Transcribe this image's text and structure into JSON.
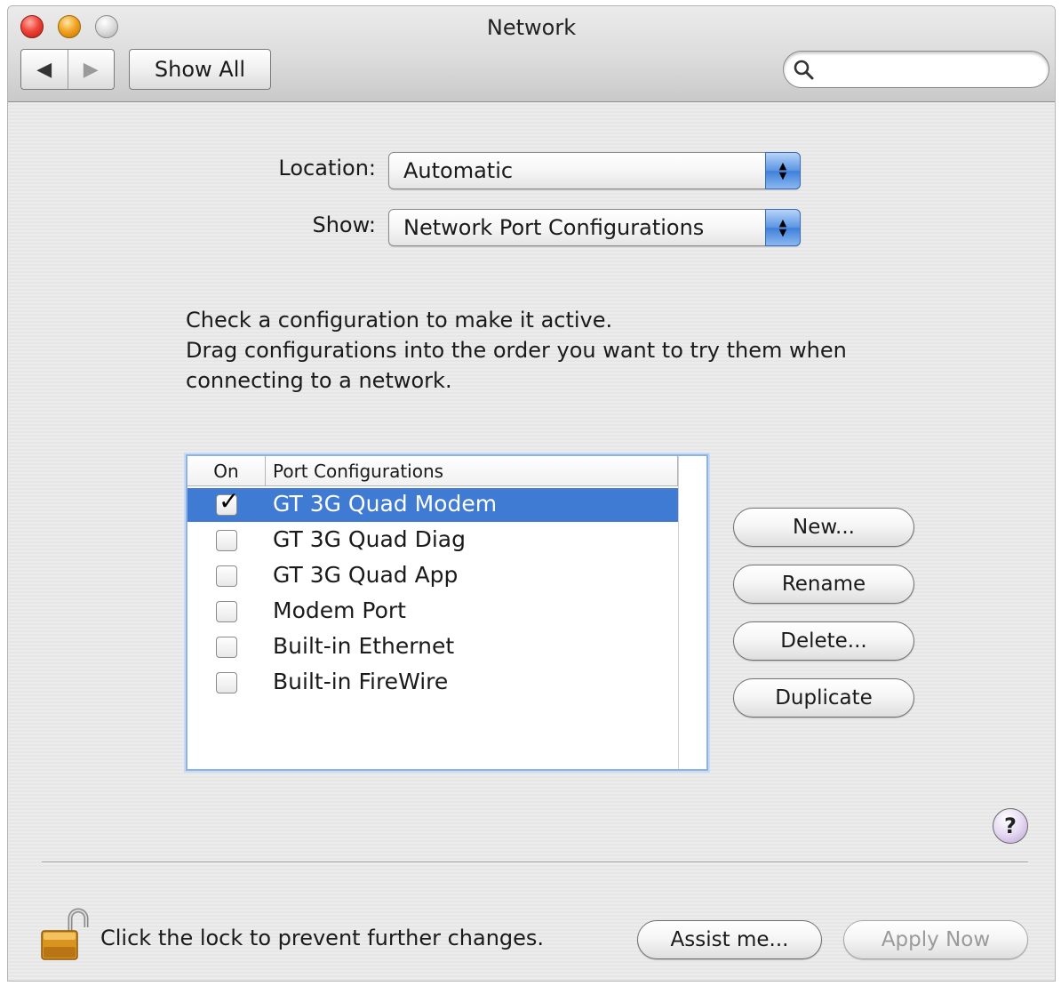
{
  "window": {
    "title": "Network"
  },
  "toolbar": {
    "back_icon": "◀",
    "forward_icon": "▶",
    "show_all_label": "Show All",
    "search_value": "",
    "search_placeholder": ""
  },
  "location": {
    "label": "Location:",
    "value": "Automatic"
  },
  "show": {
    "label": "Show:",
    "value": "Network Port Configurations"
  },
  "instructions": [
    "Check a configuration to make it active.",
    "Drag configurations into the order you want to try them when",
    "connecting to a network."
  ],
  "table": {
    "col_on": "On",
    "col_name": "Port Configurations",
    "rows": [
      {
        "name": "GT 3G Quad Modem",
        "checked": true,
        "selected": true
      },
      {
        "name": "GT 3G Quad Diag",
        "checked": false,
        "selected": false
      },
      {
        "name": "GT 3G Quad App",
        "checked": false,
        "selected": false
      },
      {
        "name": "Modem Port",
        "checked": false,
        "selected": false
      },
      {
        "name": "Built-in Ethernet",
        "checked": false,
        "selected": false
      },
      {
        "name": "Built-in FireWire",
        "checked": false,
        "selected": false
      }
    ]
  },
  "side_buttons": {
    "new": "New...",
    "rename": "Rename",
    "delete": "Delete...",
    "duplicate": "Duplicate"
  },
  "help_label": "?",
  "footer": {
    "lock_text": "Click the lock to prevent further changes.",
    "assist_label": "Assist me...",
    "apply_label": "Apply Now"
  },
  "colors": {
    "selection": "#3f7ad3",
    "focus_ring": "#8db3e6",
    "close": "#f0453a",
    "minimize": "#f3a524"
  }
}
